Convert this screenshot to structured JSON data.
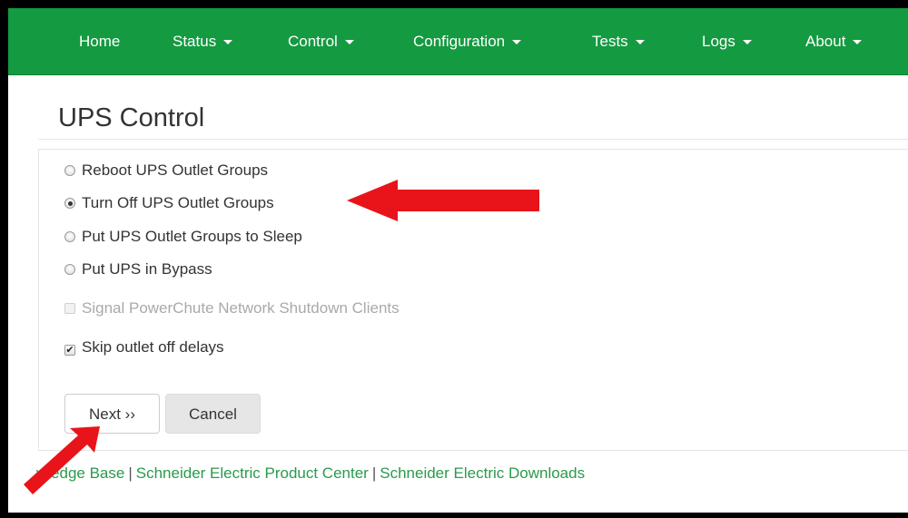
{
  "nav": {
    "items": [
      {
        "label": "Home",
        "dropdown": false
      },
      {
        "label": "Status",
        "dropdown": true
      },
      {
        "label": "Control",
        "dropdown": true
      },
      {
        "label": "Configuration",
        "dropdown": true
      },
      {
        "label": "Tests",
        "dropdown": true
      },
      {
        "label": "Logs",
        "dropdown": true
      },
      {
        "label": "About",
        "dropdown": true
      }
    ]
  },
  "page": {
    "title": "UPS Control"
  },
  "options": {
    "radios": [
      {
        "label": "Reboot UPS Outlet Groups",
        "checked": false
      },
      {
        "label": "Turn Off UPS Outlet Groups",
        "checked": true
      },
      {
        "label": "Put UPS Outlet Groups to Sleep",
        "checked": false
      },
      {
        "label": "Put UPS in Bypass",
        "checked": false
      }
    ],
    "checkboxes": [
      {
        "label": "Signal PowerChute Network Shutdown Clients",
        "checked": false,
        "disabled": true
      },
      {
        "label": "Skip outlet off delays",
        "checked": true,
        "disabled": false
      }
    ]
  },
  "buttons": {
    "next_label": "Next ››",
    "cancel_label": "Cancel"
  },
  "footer": {
    "links": [
      "wledge Base",
      "Schneider Electric Product Center",
      "Schneider Electric Downloads"
    ],
    "separator": "|"
  },
  "colors": {
    "navbar": "#149a40",
    "link": "#2a9a4c",
    "annotation_arrow": "#e8141a"
  },
  "icons": {
    "caret": "chevron-down-icon",
    "annotation": "red-arrow-icon"
  }
}
